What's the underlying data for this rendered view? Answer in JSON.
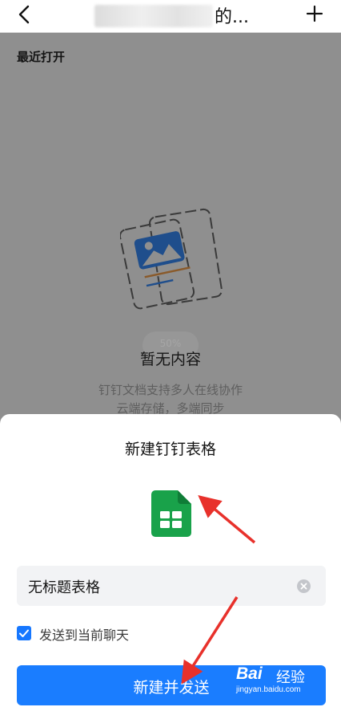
{
  "header": {
    "title_suffix": "的...",
    "back_icon": "chevron-left-icon",
    "add_icon": "plus-icon"
  },
  "main": {
    "recent_label": "最近打开",
    "empty_pill": "50%",
    "empty_title": "暂无内容",
    "empty_desc_line1": "钉钉文档支持多人在线协作",
    "empty_desc_line2": "云端存储，多端同步"
  },
  "sheet": {
    "title": "新建钉钉表格",
    "icon": "spreadsheet-icon",
    "name_input_value": "无标题表格",
    "clear_icon": "clear-icon",
    "send_to_chat_label": "发送到当前聊天",
    "send_to_chat_checked": true,
    "create_button_label": "新建并发送"
  },
  "watermark": {
    "logo_text": "Bai",
    "logo_suffix": "经验",
    "url": "jingyan.baidu.com"
  },
  "colors": {
    "accent": "#1677ff",
    "sheet_icon_green": "#19a24a",
    "overlay": "#8f8f8f",
    "annotation_arrow": "#e8312b"
  }
}
